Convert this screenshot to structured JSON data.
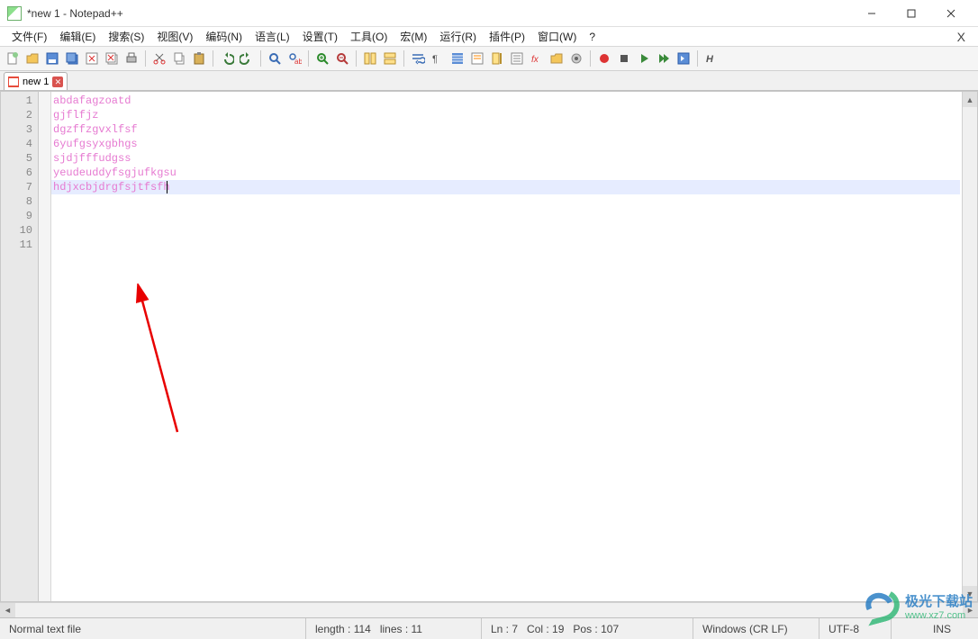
{
  "window": {
    "title": "*new 1 - Notepad++"
  },
  "menus": [
    "文件(F)",
    "编辑(E)",
    "搜索(S)",
    "视图(V)",
    "编码(N)",
    "语言(L)",
    "设置(T)",
    "工具(O)",
    "宏(M)",
    "运行(R)",
    "插件(P)",
    "窗口(W)",
    "?"
  ],
  "toolbar_icons": [
    "new-file-icon",
    "open-file-icon",
    "save-icon",
    "save-all-icon",
    "close-icon",
    "close-all-icon",
    "print-icon",
    "sep",
    "cut-icon",
    "copy-icon",
    "paste-icon",
    "sep",
    "undo-icon",
    "redo-icon",
    "sep",
    "find-icon",
    "replace-icon",
    "sep",
    "zoom-in-icon",
    "zoom-out-icon",
    "sep",
    "sync-v-icon",
    "sync-h-icon",
    "sep",
    "word-wrap-icon",
    "show-all-chars-icon",
    "indent-guide-icon",
    "lang-udl-icon",
    "doc-map-icon",
    "doc-list-icon",
    "func-list-icon",
    "folder-icon",
    "monitor-icon",
    "sep",
    "record-macro-icon",
    "stop-macro-icon",
    "play-macro-icon",
    "play-multi-icon",
    "save-macro-icon",
    "sep",
    "spellcheck-icon"
  ],
  "tab": {
    "label": "new 1"
  },
  "editor": {
    "lines": [
      "abdafagzoatd",
      "gjflfjz",
      "dgzffzgvxlfsf",
      "6yufgsyxgbhgs",
      "sjdjfffudgss",
      "yeudeuddyfsgjufkgsu",
      "hdjxcbjdrgfsjtfsfh"
    ],
    "current_line_index": 6,
    "caret_col": 18,
    "total_gutter_lines": 11
  },
  "status": {
    "filetype": "Normal text file",
    "length_label": "length : 114",
    "lines_label": "lines : 11",
    "ln_label": "Ln : 7",
    "col_label": "Col : 19",
    "pos_label": "Pos : 107",
    "eol": "Windows (CR LF)",
    "encoding": "UTF-8",
    "ovr": "INS"
  },
  "watermark": {
    "zh": "极光下载站",
    "en": "www.xz7.com"
  }
}
